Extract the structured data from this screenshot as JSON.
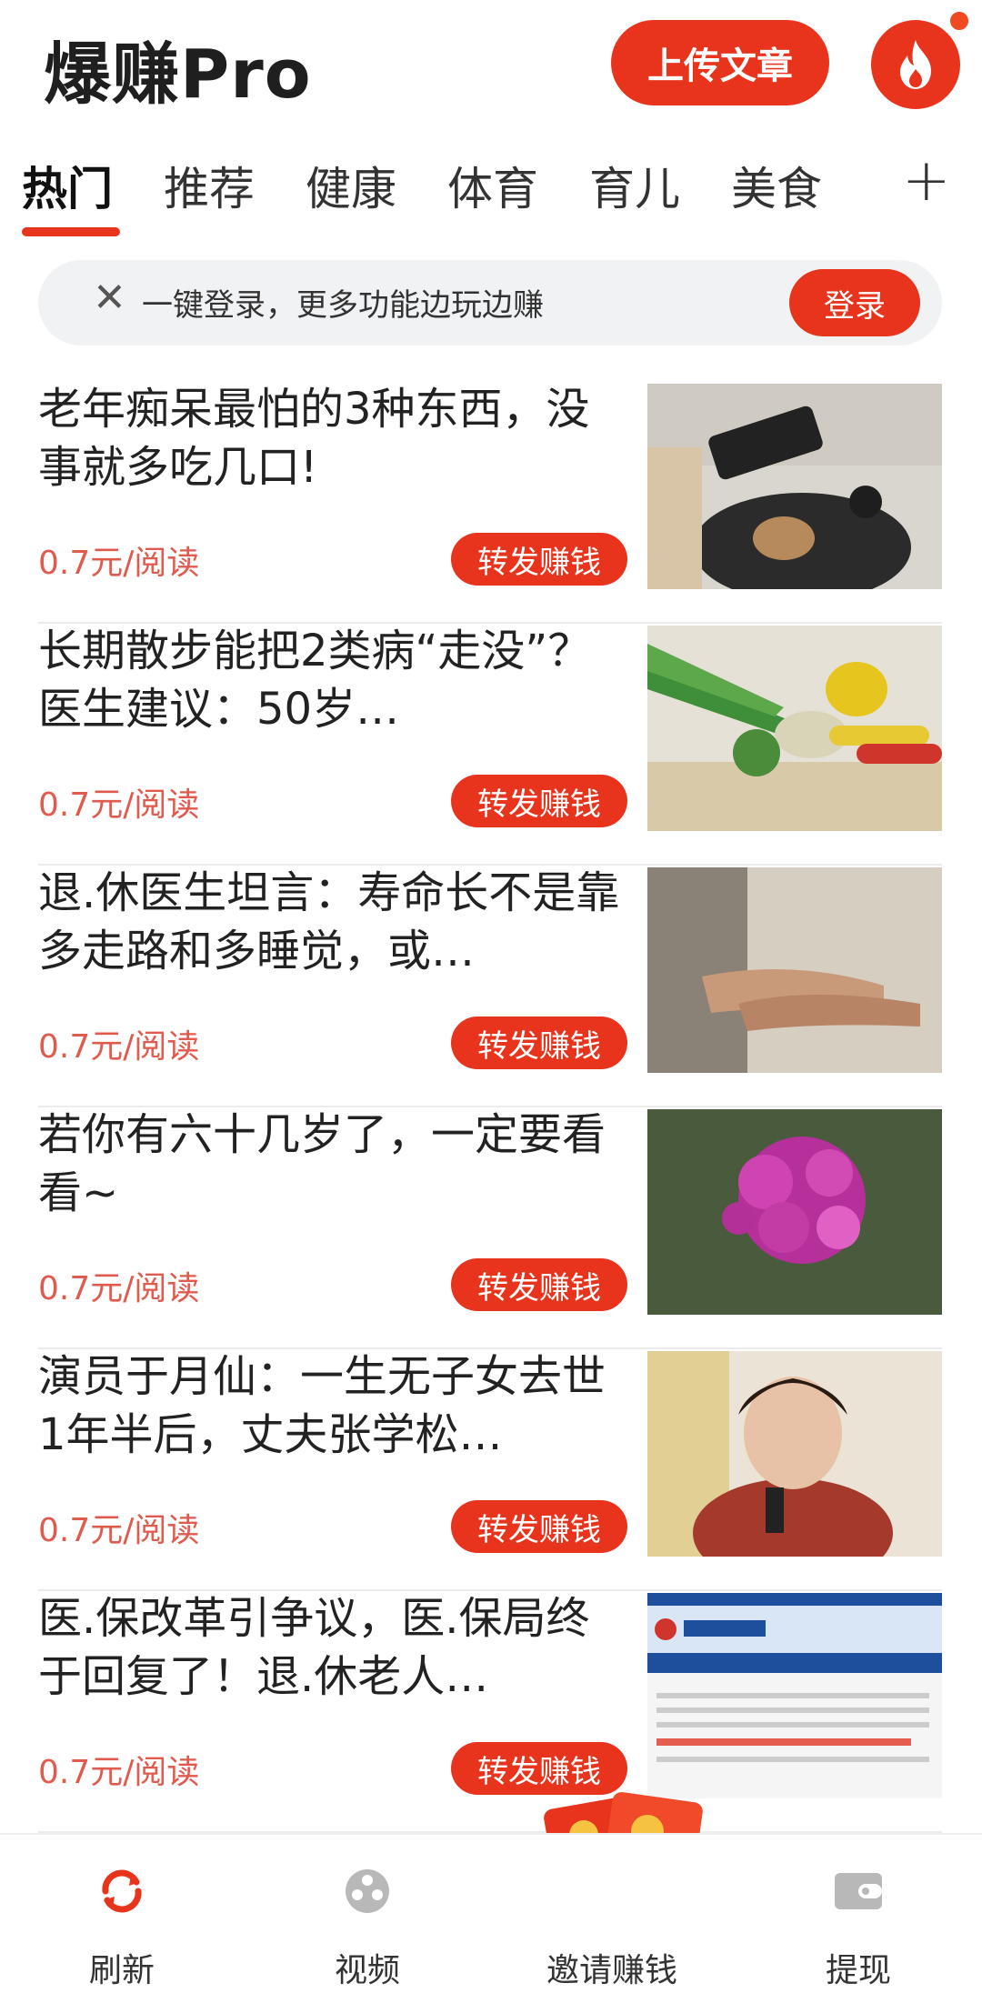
{
  "header": {
    "app_title": "爆赚Pro",
    "upload_label": "上传文章"
  },
  "tabs": [
    {
      "label": "热门",
      "active": true
    },
    {
      "label": "推荐"
    },
    {
      "label": "健康"
    },
    {
      "label": "体育"
    },
    {
      "label": "育儿"
    },
    {
      "label": "美食"
    }
  ],
  "banner": {
    "text": "一键登录，更多功能边玩边赚",
    "login_label": "登录"
  },
  "articles": [
    {
      "title": "老年痴呆最怕的3种东西，没事就多吃几口!",
      "price": "0.7元/阅读",
      "action": "转发赚钱",
      "thumb": "phone-and-food-photo"
    },
    {
      "title": "长期散步能把2类病“走没”？医生建议：50岁…",
      "price": "0.7元/阅读",
      "action": "转发赚钱",
      "thumb": "vegetables-photo"
    },
    {
      "title": "退.休医生坦言：寿命长不是靠多走路和多睡觉，或…",
      "price": "0.7元/阅读",
      "action": "转发赚钱",
      "thumb": "holding-hands-photo"
    },
    {
      "title": "若你有六十几岁了，一定要看看~",
      "price": "0.7元/阅读",
      "action": "转发赚钱",
      "thumb": "pink-flowers-photo"
    },
    {
      "title": "演员于月仙：一生无子女去世1年半后，丈夫张学松…",
      "price": "0.7元/阅读",
      "action": "转发赚钱",
      "thumb": "woman-portrait-photo"
    },
    {
      "title": "医.保改革引争议，医.保局终于回复了！退.休老人…",
      "price": "0.7元/阅读",
      "action": "转发赚钱",
      "thumb": "website-screenshot"
    }
  ],
  "bottom_nav": {
    "refresh": "刷新",
    "video": "视频",
    "invite": "邀请赚钱",
    "withdraw": "提现"
  },
  "colors": {
    "accent": "#e8341c",
    "price": "#e05a4e"
  }
}
